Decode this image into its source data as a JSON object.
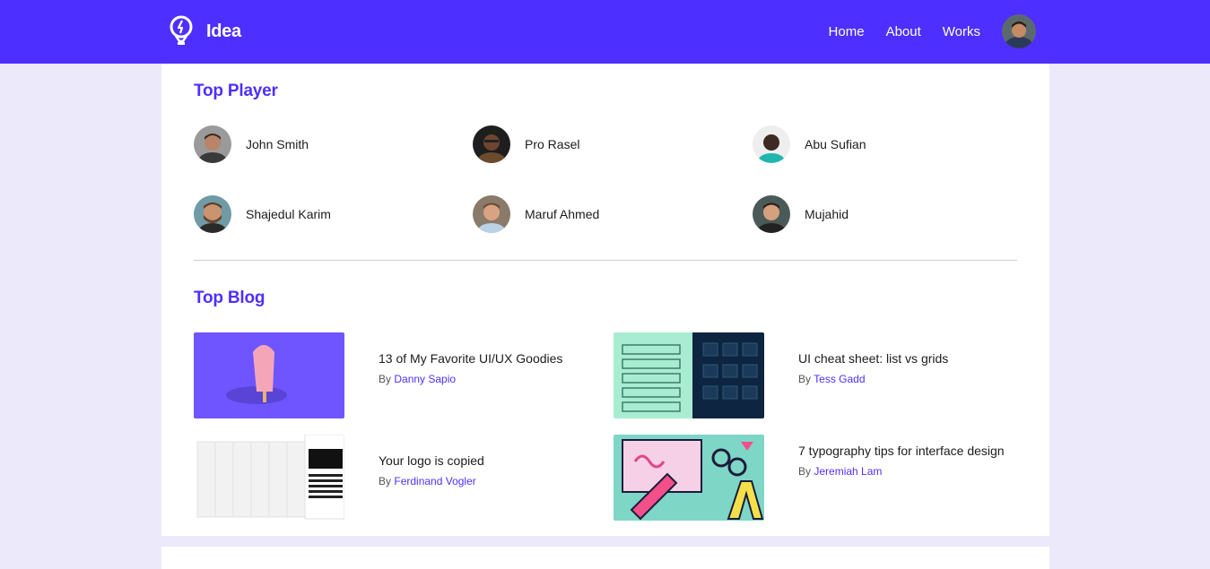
{
  "header": {
    "brand": "Idea",
    "nav": [
      "Home",
      "About",
      "Works"
    ],
    "accent": "#4d30ff"
  },
  "players": {
    "title": "Top Player",
    "items": [
      {
        "name": "John Smith"
      },
      {
        "name": "Pro Rasel"
      },
      {
        "name": "Abu Sufian"
      },
      {
        "name": "Shajedul Karim"
      },
      {
        "name": "Maruf Ahmed"
      },
      {
        "name": "Mujahid"
      }
    ]
  },
  "blog": {
    "title": "Top Blog",
    "by_prefix": "By",
    "posts": [
      {
        "title": "13 of My Favorite UI/UX Goodies",
        "author": "Danny Sapio"
      },
      {
        "title": "UI cheat sheet: list vs grids",
        "author": "Tess Gadd"
      },
      {
        "title": "Your logo is copied",
        "author": "Ferdinand Vogler"
      },
      {
        "title": "7 typography tips for interface design",
        "author": "Jeremiah Lam"
      }
    ]
  }
}
